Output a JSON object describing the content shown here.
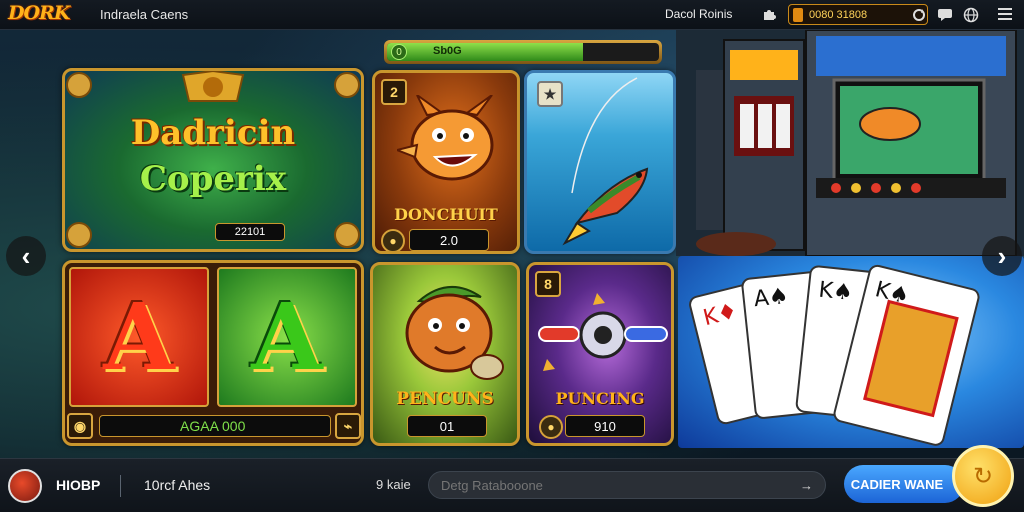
{
  "header": {
    "logo": "DORK",
    "app_title": "Indraela Caens",
    "link": "Dacol Roinis",
    "balance": "0080 31808",
    "icons": [
      "puzzle-icon",
      "refresh-icon",
      "chat-icon",
      "globe-icon",
      "menu-icon"
    ]
  },
  "progress": {
    "label": "Sb0G",
    "icon": "0",
    "level": 0.72
  },
  "games": [
    {
      "title_line1": "Dadricin",
      "title_line2": "Coperix",
      "value": "22101"
    },
    {
      "title": "DONCHUIT",
      "badge": "2",
      "value": "2.0"
    },
    {
      "title": "",
      "badge": "★"
    },
    {
      "letter_left": "A",
      "letter_right": "A",
      "value": "AGAA 000"
    },
    {
      "title": "PENCUNS",
      "value": "01"
    },
    {
      "title": "PUNCING",
      "badge": "8",
      "value": "910"
    }
  ],
  "nav": {
    "prev": "‹",
    "next": "›"
  },
  "footer": {
    "username": "HIOBP",
    "link": "10rcf Ahes",
    "count_label": "9 kaie",
    "search_placeholder": "Detg Ratabooone",
    "search_arrow": "→",
    "cta_label": "CADIER WANE",
    "fab_icon": "↻"
  },
  "colors": {
    "gold": "#c9962d",
    "accent": "#1c64d6",
    "balance_text": "#ffd35a"
  }
}
